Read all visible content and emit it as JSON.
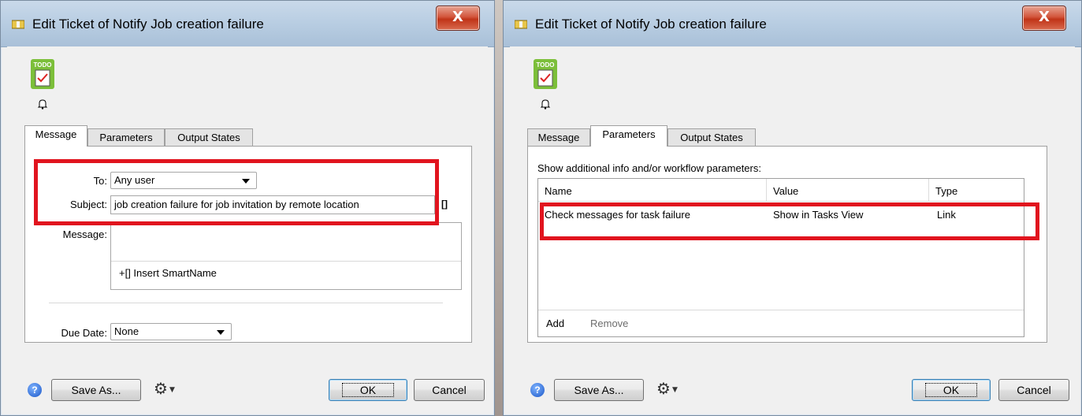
{
  "dialogs": {
    "left": {
      "title": "Edit Ticket of Notify Job creation failure",
      "tabs": [
        "Message",
        "Parameters",
        "Output States"
      ],
      "active_tab": "Message",
      "to_label": "To:",
      "to_value": "Any user",
      "subject_label": "Subject:",
      "subject_value": "job creation failure for job invitation by remote location",
      "smartname_bracket": "[]",
      "message_label": "Message:",
      "insert_smartname": "+[] Insert SmartName",
      "due_date_label": "Due Date:",
      "due_date_value": "None",
      "save_as": "Save As...",
      "ok": "OK",
      "cancel": "Cancel"
    },
    "right": {
      "title": "Edit Ticket of Notify Job creation failure",
      "tabs": [
        "Message",
        "Parameters",
        "Output States"
      ],
      "active_tab": "Parameters",
      "description": "Show additional info and/or workflow parameters:",
      "columns": [
        "Name",
        "Value",
        "Type"
      ],
      "rows": [
        {
          "name": "Check messages for task failure",
          "value": "Show in Tasks View",
          "type": "Link"
        }
      ],
      "add": "Add",
      "remove": "Remove",
      "save_as": "Save As...",
      "ok": "OK",
      "cancel": "Cancel"
    }
  },
  "icons": {
    "todo_badge": "TODO",
    "close": "X",
    "help": "?"
  },
  "colors": {
    "highlight": "#e1141e",
    "title_bar": "#b8cde2",
    "close_button": "#c03418"
  }
}
